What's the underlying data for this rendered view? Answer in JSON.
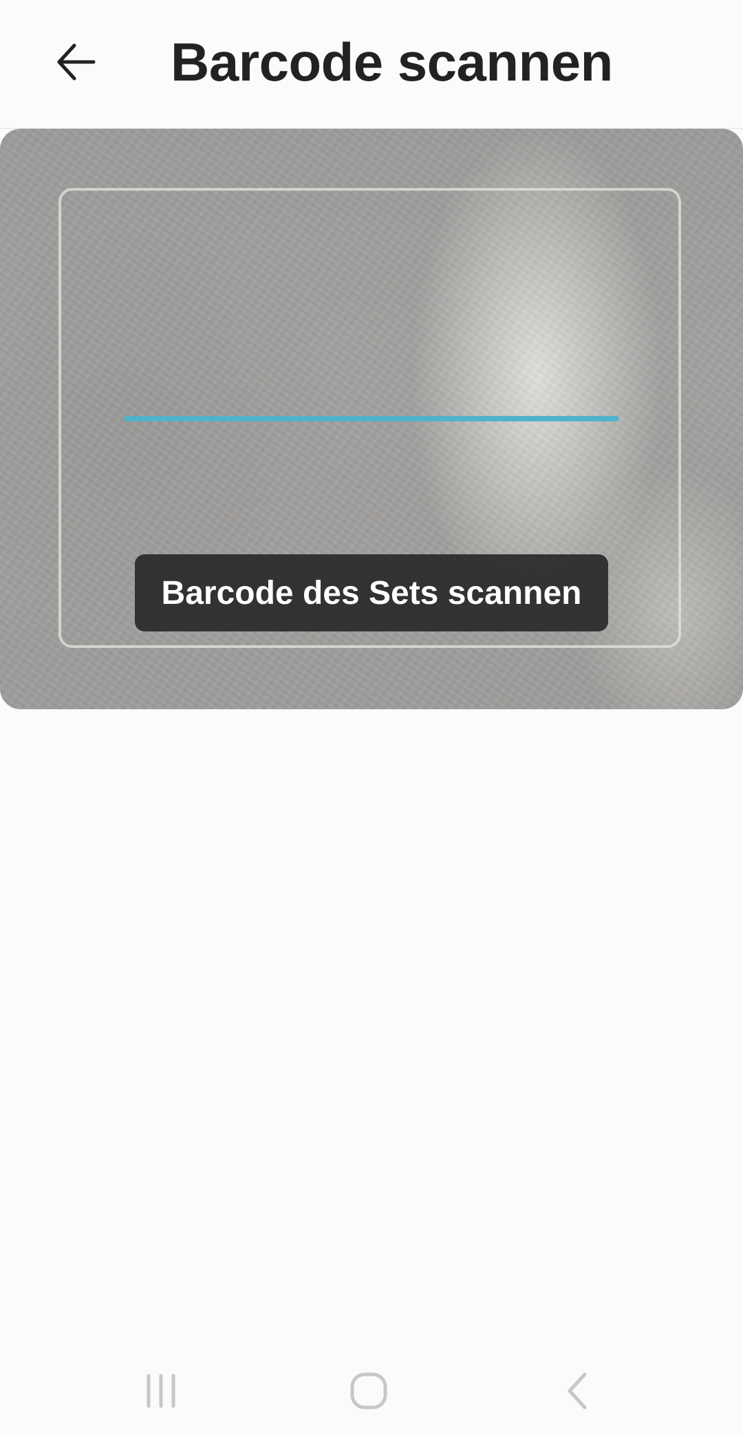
{
  "app_bar": {
    "title": "Barcode scannen",
    "back_icon": "arrow-left-icon"
  },
  "scanner": {
    "hint": "Barcode des Sets scannen",
    "scan_line_color": "#4fb3ce"
  },
  "system_nav": {
    "recents_icon": "recents-icon",
    "home_icon": "home-icon",
    "back_icon": "back-chevron-icon"
  },
  "colors": {
    "background": "#fcfbfb",
    "title": "#222222",
    "toast_bg": "#2d2b2b"
  }
}
